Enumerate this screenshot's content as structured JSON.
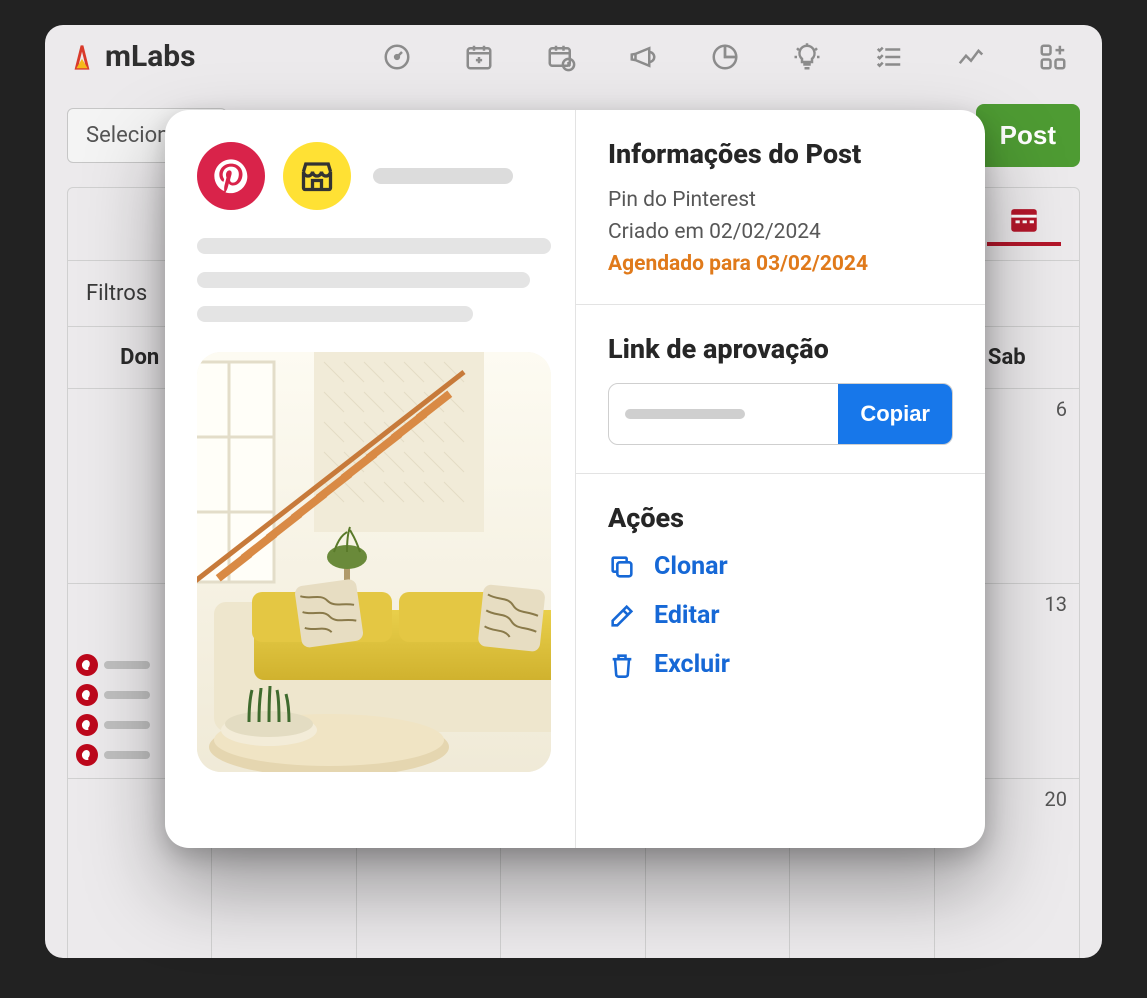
{
  "brand": {
    "name": "mLabs"
  },
  "subbar": {
    "select_label": "Selecion",
    "post_button": "Post"
  },
  "filters": {
    "label": "Filtros"
  },
  "calendar": {
    "days": [
      "Don",
      "",
      "",
      "",
      "",
      "",
      "Sab"
    ],
    "week1_numbers": [
      "",
      "",
      "",
      "",
      "",
      "",
      "6"
    ],
    "week2_numbers": [
      "",
      "",
      "",
      "",
      "",
      "",
      "13"
    ],
    "week3_numbers": [
      "",
      "",
      "",
      "",
      "",
      "",
      "20"
    ]
  },
  "modal": {
    "info": {
      "title": "Informações do Post",
      "type": "Pin do Pinterest",
      "created": "Criado em 02/02/2024",
      "scheduled": "Agendado para 03/02/2024"
    },
    "approval": {
      "title": "Link de aprovação",
      "copy": "Copiar"
    },
    "actions": {
      "title": "Ações",
      "clone": "Clonar",
      "edit": "Editar",
      "delete": "Excluir"
    }
  }
}
